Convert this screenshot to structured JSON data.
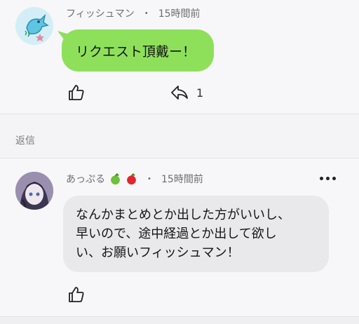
{
  "comment1": {
    "username": "フィッシュマン",
    "separator": "・",
    "time": "15時間前",
    "message": "リクエスト頂戴ー！",
    "reply_count": "1"
  },
  "section": {
    "label": "返信"
  },
  "comment2": {
    "username": "あっぷる",
    "separator": "・",
    "time": "15時間前",
    "message_lines": [
      "なんかまとめとか出した方がいいし、",
      "早いので、途中経過とか出して欲し",
      "い、お願いフィッシュマン！"
    ]
  },
  "colors": {
    "green_bubble": "#8ee05b",
    "gray_bubble": "#e9e9ec",
    "background": "#f7f7f9"
  },
  "icons": {
    "like": "thumbs-up-icon",
    "reply": "reply-icon",
    "more": "more-dots-icon",
    "green_apple": "green-apple-icon",
    "red_apple": "red-apple-icon"
  }
}
